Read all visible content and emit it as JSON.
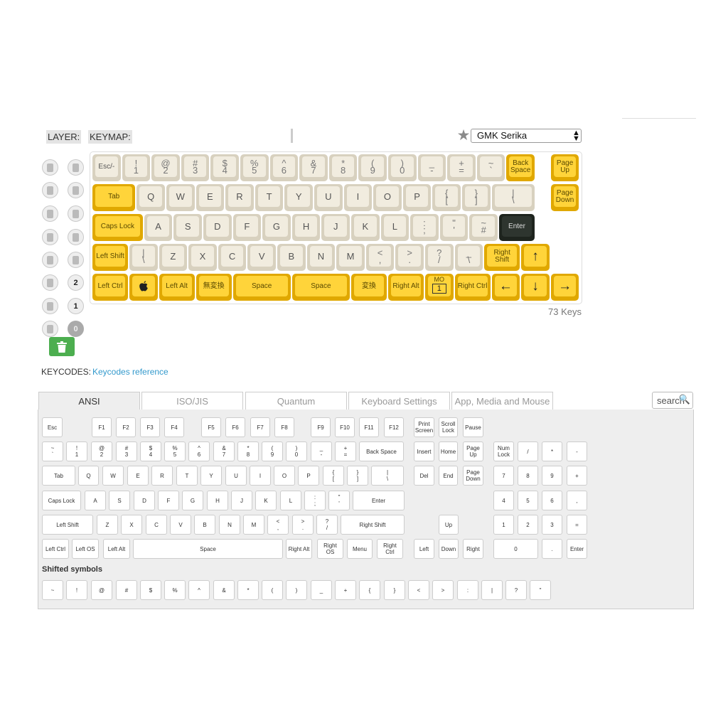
{
  "header": {
    "layer_label": "LAYER:",
    "keymap_label": "KEYMAP:"
  },
  "theme_select": {
    "value": "GMK Serika"
  },
  "keyboard": {
    "key_count": "73 Keys",
    "rows": [
      [
        [
          "Esc/-",
          "c"
        ],
        [
          "!\n1",
          "c"
        ],
        [
          "@\n2",
          "c"
        ],
        [
          "#\n3",
          "c"
        ],
        [
          "$\n4",
          "c"
        ],
        [
          "%\n5",
          "c"
        ],
        [
          "^\n6",
          "c"
        ],
        [
          "&\n7",
          "c"
        ],
        [
          "*\n8",
          "c"
        ],
        [
          "(\n9",
          "c"
        ],
        [
          ")\n0",
          "c"
        ],
        [
          "_\n-",
          "c"
        ],
        [
          "+\n=",
          "c"
        ],
        [
          "~\n`",
          "c"
        ],
        [
          "Back\nSpace",
          "y"
        ],
        [
          "Page\nUp",
          "y"
        ]
      ],
      [
        [
          "Tab",
          "y"
        ],
        [
          "Q",
          "c"
        ],
        [
          "W",
          "c"
        ],
        [
          "E",
          "c"
        ],
        [
          "R",
          "c"
        ],
        [
          "T",
          "c"
        ],
        [
          "Y",
          "c"
        ],
        [
          "U",
          "c"
        ],
        [
          "I",
          "c"
        ],
        [
          "O",
          "c"
        ],
        [
          "P",
          "c"
        ],
        [
          "{\n[",
          "c"
        ],
        [
          "}\n]",
          "c"
        ],
        [
          "|\n\\",
          "c"
        ],
        [
          "Page\nDown",
          "y"
        ]
      ],
      [
        [
          "Caps Lock",
          "y"
        ],
        [
          "A",
          "c"
        ],
        [
          "S",
          "c"
        ],
        [
          "D",
          "c"
        ],
        [
          "F",
          "c"
        ],
        [
          "G",
          "c"
        ],
        [
          "H",
          "c"
        ],
        [
          "J",
          "c"
        ],
        [
          "K",
          "c"
        ],
        [
          "L",
          "c"
        ],
        [
          ":\n;",
          "c"
        ],
        [
          "\"\n'",
          "c"
        ],
        [
          "~\n#",
          "c"
        ],
        [
          "Enter",
          "d"
        ]
      ],
      [
        [
          "Left Shift",
          "y"
        ],
        [
          "|\n\\",
          "c"
        ],
        [
          "Z",
          "c"
        ],
        [
          "X",
          "c"
        ],
        [
          "C",
          "c"
        ],
        [
          "V",
          "c"
        ],
        [
          "B",
          "c"
        ],
        [
          "N",
          "c"
        ],
        [
          "M",
          "c"
        ],
        [
          "<\n,",
          "c"
        ],
        [
          ">\n.",
          "c"
        ],
        [
          "?\n/",
          "c"
        ],
        [
          "_\n\\",
          "c"
        ],
        [
          "Right\nShift",
          "y"
        ],
        [
          "↑",
          "y"
        ]
      ],
      [
        [
          "Left Ctrl",
          "y"
        ],
        [
          "",
          "y"
        ],
        [
          "Left Alt",
          "y"
        ],
        [
          "無変換",
          "y"
        ],
        [
          "Space",
          "y"
        ],
        [
          "Space",
          "y"
        ],
        [
          "変換",
          "y"
        ],
        [
          "Right Alt",
          "y"
        ],
        [
          "MO\n1",
          "y"
        ],
        [
          "Right Ctrl",
          "y"
        ],
        [
          "←",
          "y"
        ],
        [
          "↓",
          "y"
        ],
        [
          "→",
          "y"
        ]
      ]
    ]
  },
  "layers": [
    "2",
    "1",
    "0"
  ],
  "keycodes": {
    "label": "KEYCODES:",
    "link": "Keycodes reference"
  },
  "tabs": [
    "ANSI",
    "ISO/JIS",
    "Quantum",
    "Keyboard Settings",
    "App, Media and Mouse"
  ],
  "search": {
    "value": "search"
  },
  "ansi": {
    "rows": [
      [
        "Esc",
        "F1",
        "F2",
        "F3",
        "F4",
        "F5",
        "F6",
        "F7",
        "F8",
        "F9",
        "F10",
        "F11",
        "F12",
        "Print\nScreen",
        "Scroll\nLock",
        "Pause"
      ],
      [
        "~\n`",
        "!\n1",
        "@\n2",
        "#\n3",
        "$\n4",
        "%\n5",
        "^\n6",
        "&\n7",
        "*\n8",
        "(\n9",
        ")\n0",
        "_\n-",
        "+\n=",
        "Back Space",
        "Insert",
        "Home",
        "Page\nUp",
        "Num\nLock",
        "/",
        "*",
        "-"
      ],
      [
        "Tab",
        "Q",
        "W",
        "E",
        "R",
        "T",
        "Y",
        "U",
        "I",
        "O",
        "P",
        "{\n[",
        "}\n]",
        "|\n\\",
        "Del",
        "End",
        "Page\nDown",
        "7",
        "8",
        "9",
        "+"
      ],
      [
        "Caps Lock",
        "A",
        "S",
        "D",
        "F",
        "G",
        "H",
        "J",
        "K",
        "L",
        ":\n;",
        "\"\n'",
        "Enter",
        "4",
        "5",
        "6",
        ","
      ],
      [
        "Left Shift",
        "Z",
        "X",
        "C",
        "V",
        "B",
        "N",
        "M",
        "<\n,",
        ">\n.",
        "?\n/",
        "Right Shift",
        "Up",
        "1",
        "2",
        "3",
        "="
      ],
      [
        "Left Ctrl",
        "Left OS",
        "Left Alt",
        "Space",
        "Right Alt",
        "Right\nOS",
        "Menu",
        "Right\nCtrl",
        "Left",
        "Down",
        "Right",
        "0",
        ".",
        "Enter"
      ]
    ],
    "shifted_label": "Shifted symbols",
    "shifted": [
      "~",
      "!",
      "@",
      "#",
      "$",
      "%",
      "^",
      "&",
      "*",
      "(",
      ")",
      "_",
      "+",
      "{",
      "}",
      "<",
      ">",
      ":",
      "|",
      "?",
      "\""
    ]
  }
}
